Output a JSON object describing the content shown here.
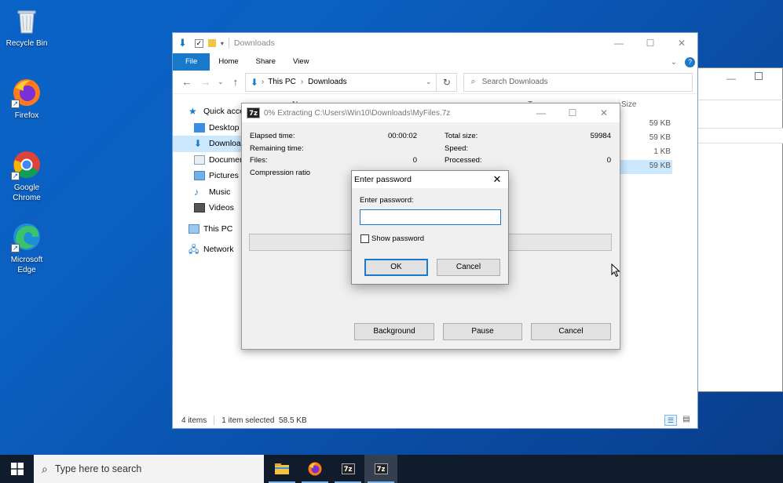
{
  "colors": {
    "accent": "#1979ca",
    "desktop": "#0a5fc0",
    "taskbar": "#101c2c"
  },
  "desktop_icons": [
    {
      "label": "Recycle Bin",
      "icon": "recycle-bin-icon"
    },
    {
      "label": "Firefox",
      "icon": "firefox-icon"
    },
    {
      "label": "Google Chrome",
      "icon": "chrome-icon"
    },
    {
      "label": "Microsoft Edge",
      "icon": "edge-icon"
    }
  ],
  "explorer": {
    "title": "Downloads",
    "ribbon_tabs": [
      "File",
      "Home",
      "Share",
      "View"
    ],
    "breadcrumb": [
      "This PC",
      "Downloads"
    ],
    "search_placeholder": "Search Downloads",
    "sidebar": [
      "Quick access",
      "Desktop",
      "Downloads",
      "Documents",
      "Pictures",
      "Music",
      "Videos",
      "This PC",
      "Network"
    ],
    "column_name": "N",
    "column_type": "T",
    "column_size": "Size",
    "sizes": [
      "59 KB",
      "59 KB",
      "1 KB",
      "59 KB"
    ],
    "status_items": "4 items",
    "status_selected": "1 item selected  58.5 KB"
  },
  "sevenzip": {
    "title": "0% Extracting C:\\Users\\Win10\\Downloads\\MyFiles.7z",
    "elapsed_label": "Elapsed time:",
    "elapsed_value": "00:00:02",
    "remaining_label": "Remaining time:",
    "files_label": "Files:",
    "files_value": "0",
    "ratio_label": "Compression ratio",
    "total_label": "Total size:",
    "total_value": "59984",
    "speed_label": "Speed:",
    "processed_label": "Processed:",
    "processed_value": "0",
    "background_label": "Background",
    "pause_label": "Pause",
    "cancel_label": "Cancel"
  },
  "password_dialog": {
    "title": "Enter password",
    "prompt": "Enter password:",
    "value": "",
    "show_password_label": "Show password",
    "show_password_checked": false,
    "ok_label": "OK",
    "cancel_label": "Cancel"
  },
  "taskbar": {
    "search_placeholder": "Type here to search",
    "apps": [
      "file-explorer-icon",
      "firefox-icon",
      "7zip-icon",
      "7zip-icon"
    ],
    "sevenz_text": "7z"
  }
}
